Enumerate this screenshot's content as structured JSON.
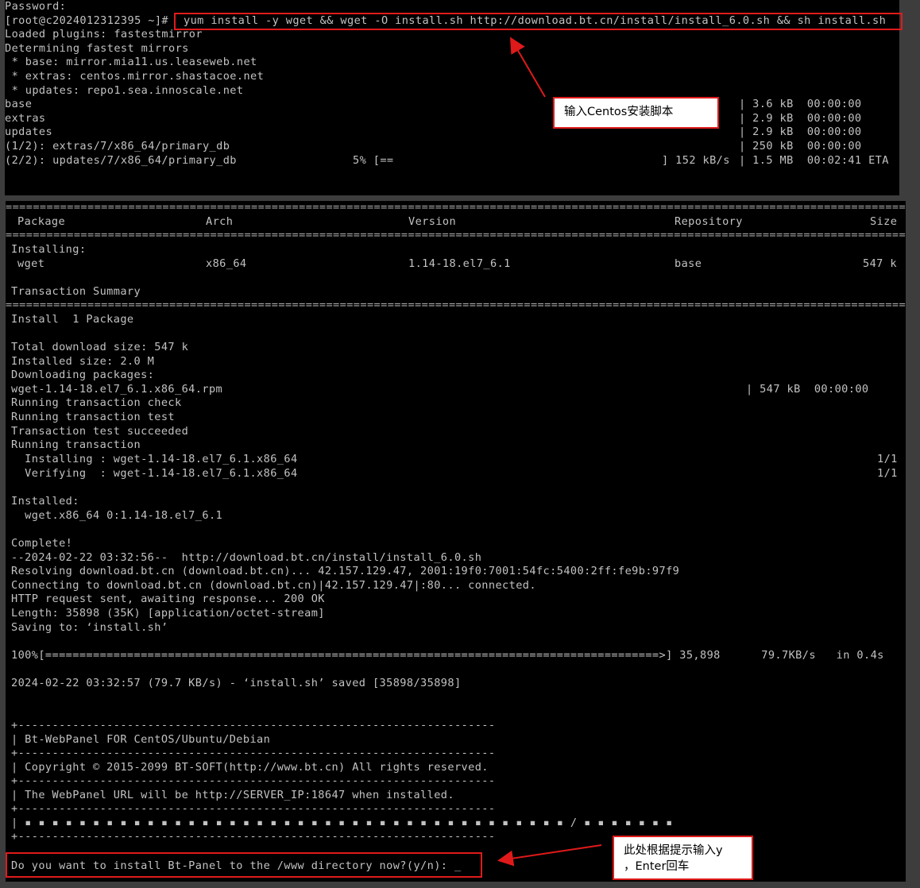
{
  "top_terminal": {
    "lines": [
      "Password:",
      "[root@c2024012312395 ~]# ",
      "Loaded plugins: fastestmirror",
      "Determining fastest mirrors",
      " * base: mirror.mia11.us.leaseweb.net",
      " * extras: centos.mirror.shastacoe.net",
      " * updates: repo1.sea.innoscale.net",
      "base",
      "extras",
      "updates",
      "(1/2): extras/7/x86_64/primary_db",
      "(2/2): updates/7/x86_64/primary_db"
    ],
    "command": "yum install -y wget && wget -O install.sh http://download.bt.cn/install/install_6.0.sh && sh install.sh",
    "repo_stats": [
      "| 3.6 kB  00:00:00",
      "| 2.9 kB  00:00:00",
      "| 2.9 kB  00:00:00",
      "| 250 kB  00:00:00",
      "| 1.5 MB  00:02:41 ETA"
    ],
    "progress_pct": "5% [==",
    "progress_rate": "] 152 kB/s"
  },
  "bottom_terminal": {
    "headers": [
      "Package",
      "Arch",
      "Version",
      "Repository",
      "Size"
    ],
    "installing_label": "Installing:",
    "package_row": [
      "wget",
      "x86_64",
      "1.14-18.el7_6.1",
      "base",
      "547 k"
    ],
    "lines": [
      "Transaction Summary",
      "Install  1 Package",
      "Total download size: 547 k",
      "Installed size: 2.0 M",
      "Downloading packages:",
      "wget-1.14-18.el7_6.1.x86_64.rpm",
      "Running transaction check",
      "Running transaction test",
      "Transaction test succeeded",
      "Running transaction",
      "  Installing : wget-1.14-18.el7_6.1.x86_64",
      "  Verifying  : wget-1.14-18.el7_6.1.x86_64",
      "Installed:",
      "  wget.x86_64 0:1.14-18.el7_6.1",
      "Complete!",
      "--2024-02-22 03:32:56--  http://download.bt.cn/install/install_6.0.sh",
      "Resolving download.bt.cn (download.bt.cn)... 42.157.129.47, 2001:19f0:7001:54fc:5400:2ff:fe9b:97f9",
      "Connecting to download.bt.cn (download.bt.cn)|42.157.129.47|:80... connected.",
      "HTTP request sent, awaiting response... 200 OK",
      "Length: 35898 (35K) [application/octet-stream]",
      "Saving to: ‘install.sh’",
      "100%[==========================================================================================>] 35,898      79.7KB/s   in 0.4s",
      "2024-02-22 03:32:57 (79.7 KB/s) - ‘install.sh’ saved [35898/35898]",
      "+----------------------------------------------------------------------",
      "| Bt-WebPanel FOR CentOS/Ubuntu/Debian",
      "+----------------------------------------------------------------------",
      "| Copyright © 2015-2099 BT-SOFT(http://www.bt.cn) All rights reserved.",
      "+----------------------------------------------------------------------",
      "| The WebPanel URL will be http://SERVER_IP:18647 when installed.",
      "+----------------------------------------------------------------------",
      "| ▪ ▪ ▪ ▪ ▪ ▪ ▪ ▪ ▪ ▪ ▪ ▪ ▪ ▪ ▪ ▪ ▪ ▪ ▪ ▪ ▪ ▪ ▪ ▪ ▪ ▪ ▪ ▪ ▪ ▪ ▪ ▪ ▪ ▪ ▪ ▪ ▪ ▪ ▪ ▪ / ▪ ▪ ▪ ▪ ▪ ▪ ▪",
      "+----------------------------------------------------------------------"
    ],
    "download_stat": "| 547 kB  00:00:00",
    "counters": [
      "1/1",
      "1/1"
    ],
    "prompt": "Do you want to install Bt-Panel to the /www directory now?(y/n): _"
  },
  "annotations": {
    "note1": "输入Centos安装脚本",
    "note2_line1": "此处根据提示输入y",
    "note2_line2": "，Enter回车",
    "color": "#e01a1a"
  }
}
